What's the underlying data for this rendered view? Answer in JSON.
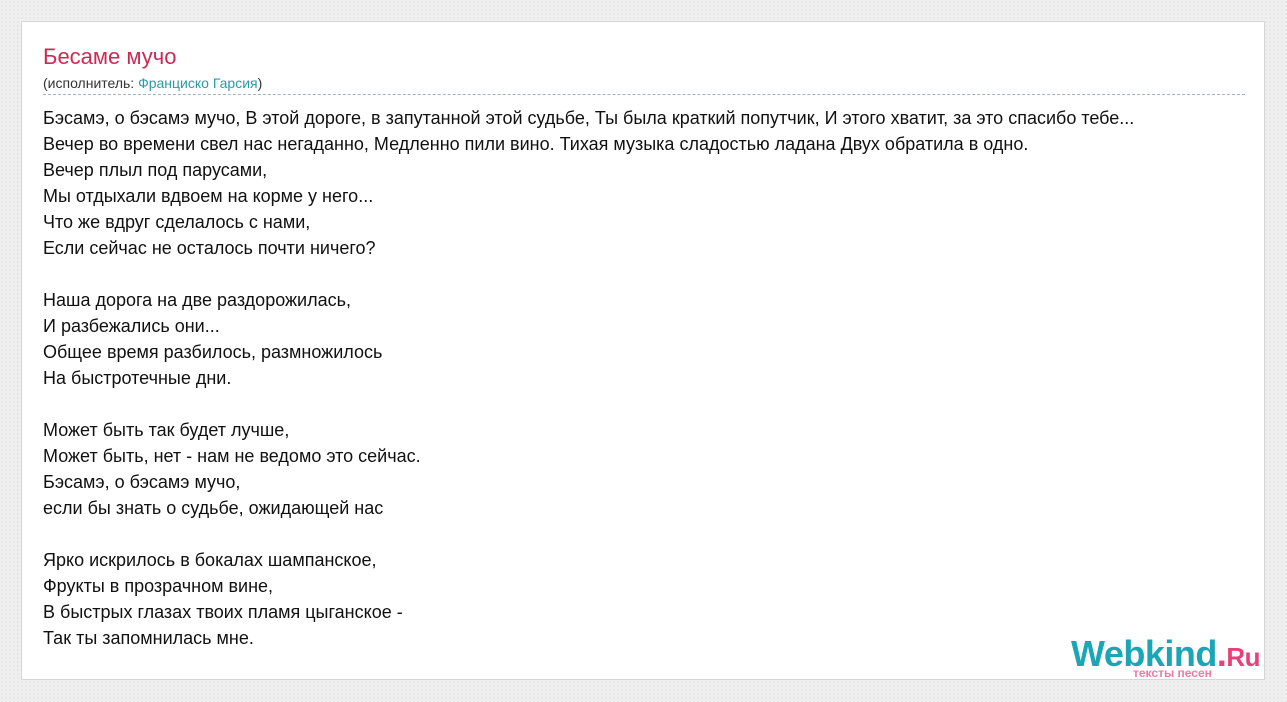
{
  "song": {
    "title": "Бесаме мучо",
    "artist_prefix": "(исполнитель: ",
    "artist_name": "Франциско Гарсия",
    "artist_suffix": ")"
  },
  "lyrics": [
    "Бэсамэ, о бэсамэ мучо, В этой дороге, в запутанной этой судьбе, Ты была краткий попутчик, И этого хватит, за это спасибо тебе...",
    "Вечер во времени свел нас негаданно, Медленно пили вино. Тихая музыка сладостью ладана Двух обратила в одно.",
    "Вечер плыл под парусами,",
    "Мы отдыхали вдвоем на корме у него...",
    "Что же вдруг сделалось с нами,",
    "Если сейчас не осталось почти ничего?",
    "",
    "Наша дорога на две раздорожилась,",
    "И разбежались они...",
    "Общее время разбилось, размножилось",
    "На быстротечные дни.",
    "",
    "Может быть так будет лучше,",
    "Может быть, нет - нам не ведомо это сейчас.",
    "Бэсамэ, о бэсамэ мучо,",
    "если бы знать о судьбе, ожидающей нас",
    "",
    "Ярко искрилось в бокалах шампанское,",
    "Фрукты в прозрачном вине,",
    "В быстрых глазах твоих пламя цыганское -",
    "Так ты запомнилась мне."
  ],
  "logo": {
    "name": "Webkind",
    "dot": ".",
    "tld": "Ru",
    "tagline": "тексты песен"
  },
  "colors": {
    "title": "#cc2a55",
    "link": "#2a9aa8",
    "logo_primary": "#1ba6b5",
    "logo_accent": "#e8417a"
  }
}
